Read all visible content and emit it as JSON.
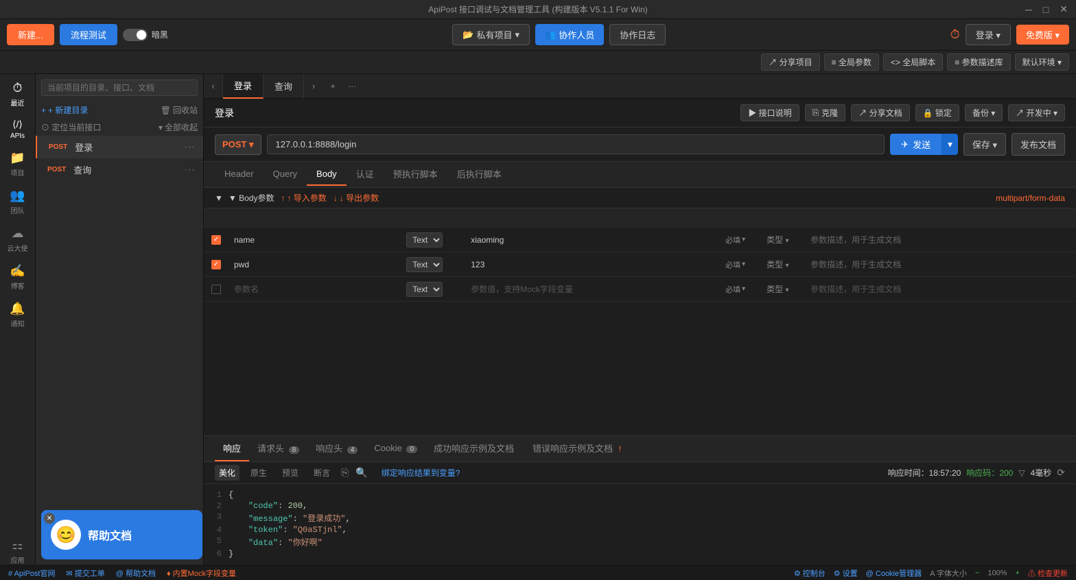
{
  "titlebar": {
    "title": "ApiPost 接口调试与文档管理工具 (构建版本 V5.1.1 For Win)",
    "min": "─",
    "max": "□",
    "close": "✕"
  },
  "toolbar": {
    "new_label": "新建...",
    "flow_label": "流程测试",
    "dark_label": "暗黑",
    "private_label": "私有项目",
    "collab_label": "协作人员",
    "log_label": "协作日志",
    "login_label": "登录 ▾",
    "free_label": "免费版 ▾"
  },
  "project_toolbar": {
    "share_label": "↗ 分享项目",
    "global_param_label": "≡ 全局参数",
    "global_script_label": "<> 全局脚本",
    "param_db_label": "≡ 参数描述库",
    "env_label": "默认环境 ▾"
  },
  "sidebar": {
    "search_placeholder": "当前项目的目录、接口、文档",
    "new_dir_label": "+ 新建目录",
    "recycle_label": "回收站",
    "locate_label": "⊙ 定位当前接口",
    "collapse_label": "全部收起",
    "items": [
      {
        "method": "POST",
        "name": "登录",
        "active": true
      },
      {
        "method": "POST",
        "name": "查询",
        "active": false
      }
    ]
  },
  "sidebar_icons": [
    {
      "name": "recent-icon",
      "label": "最近",
      "icon": "⏱"
    },
    {
      "name": "api-icon",
      "label": "APIs",
      "icon": "⟨/⟩"
    },
    {
      "name": "project-icon",
      "label": "项目",
      "icon": "📁"
    },
    {
      "name": "team-icon",
      "label": "团队",
      "icon": "👥"
    },
    {
      "name": "cloud-icon",
      "label": "云大使",
      "icon": "☁"
    },
    {
      "name": "blog-icon",
      "label": "博客",
      "icon": "✍"
    },
    {
      "name": "notify-icon",
      "label": "通知",
      "icon": "🔔"
    },
    {
      "name": "apps-icon",
      "label": "应用",
      "icon": "⚏"
    }
  ],
  "tabs": [
    {
      "label": "登录",
      "active": true
    },
    {
      "label": "查询",
      "active": false
    }
  ],
  "interface": {
    "title": "登录",
    "doc_label": "▶ 接口说明",
    "clone_label": "克隆",
    "share_label": "↗ 分享文档",
    "lock_label": "🔒 锁定",
    "backup_label": "备份 ▾",
    "dev_label": "↗ 开发中 ▾"
  },
  "url_bar": {
    "method": "POST ▾",
    "url": "127.0.0.1:8888/login",
    "send_label": "✈ 发送",
    "save_label": "保存",
    "publish_label": "发布文档"
  },
  "request_tabs": [
    "Header",
    "Query",
    "Body",
    "认证",
    "预执行脚本",
    "后执行脚本"
  ],
  "body_section": {
    "label": "▼ Body参数",
    "import_label": "↑ 导入参数",
    "export_label": "↓ 导出参数",
    "form_type": "multipart/form-data",
    "params": [
      {
        "checked": true,
        "name": "name",
        "type": "Text",
        "value": "xiaoming",
        "required": "必填",
        "type_label": "类型",
        "desc": "参数描述，用于生成文档"
      },
      {
        "checked": true,
        "name": "pwd",
        "type": "Text",
        "value": "123",
        "required": "必填",
        "type_label": "类型",
        "desc": "参数描述，用于生成文档"
      },
      {
        "checked": false,
        "name": "",
        "type": "Text",
        "value": "",
        "required": "必填",
        "type_label": "类型",
        "desc": "参数描述，用于生成文档",
        "name_placeholder": "参数名",
        "value_placeholder": "参数值，支持Mock字段变量"
      }
    ]
  },
  "response_tabs": [
    {
      "label": "响应",
      "active": true
    },
    {
      "label": "请求头",
      "count": "8"
    },
    {
      "label": "响应头",
      "count": "4"
    },
    {
      "label": "Cookie",
      "count": "0"
    },
    {
      "label": "成功响应示例及文档",
      "dot": "green"
    },
    {
      "label": "错误响应示例及文档",
      "dot": "red"
    }
  ],
  "response_toolbar": {
    "beautify_label": "美化",
    "raw_label": "原生",
    "preview_label": "预览",
    "断言_label": "断言",
    "bind_label": "绑定响应结果到变量?",
    "time_label": "响应时间：18:57:20",
    "code_label": "响应码：200",
    "size_label": "4毫秒"
  },
  "response_code": [
    {
      "num": 1,
      "content": "{"
    },
    {
      "num": 2,
      "content": "    \"code\": 200,"
    },
    {
      "num": 3,
      "content": "    \"message\": \"登录成功\","
    },
    {
      "num": 4,
      "content": "    \"token\": \"Q0aSTjnl\","
    },
    {
      "num": 5,
      "content": "    \"data\": \"你好啊\""
    },
    {
      "num": 6,
      "content": "}"
    }
  ],
  "status_bar": {
    "website_label": "# ApiPost官网",
    "feedback_label": "✉ 提交工单",
    "help_label": "@ 帮助文档",
    "mock_label": "♦ 内置Mock字段变量",
    "console_label": "⚙ 控制台",
    "settings_label": "⚙ 设置",
    "cookie_label": "@ Cookie管理器",
    "font_label": "A 字体大小",
    "zoom_label": "100%",
    "update_label": "⚠ 检查更新"
  },
  "help_widget": {
    "close_label": "关闭",
    "text": "帮助文档"
  }
}
